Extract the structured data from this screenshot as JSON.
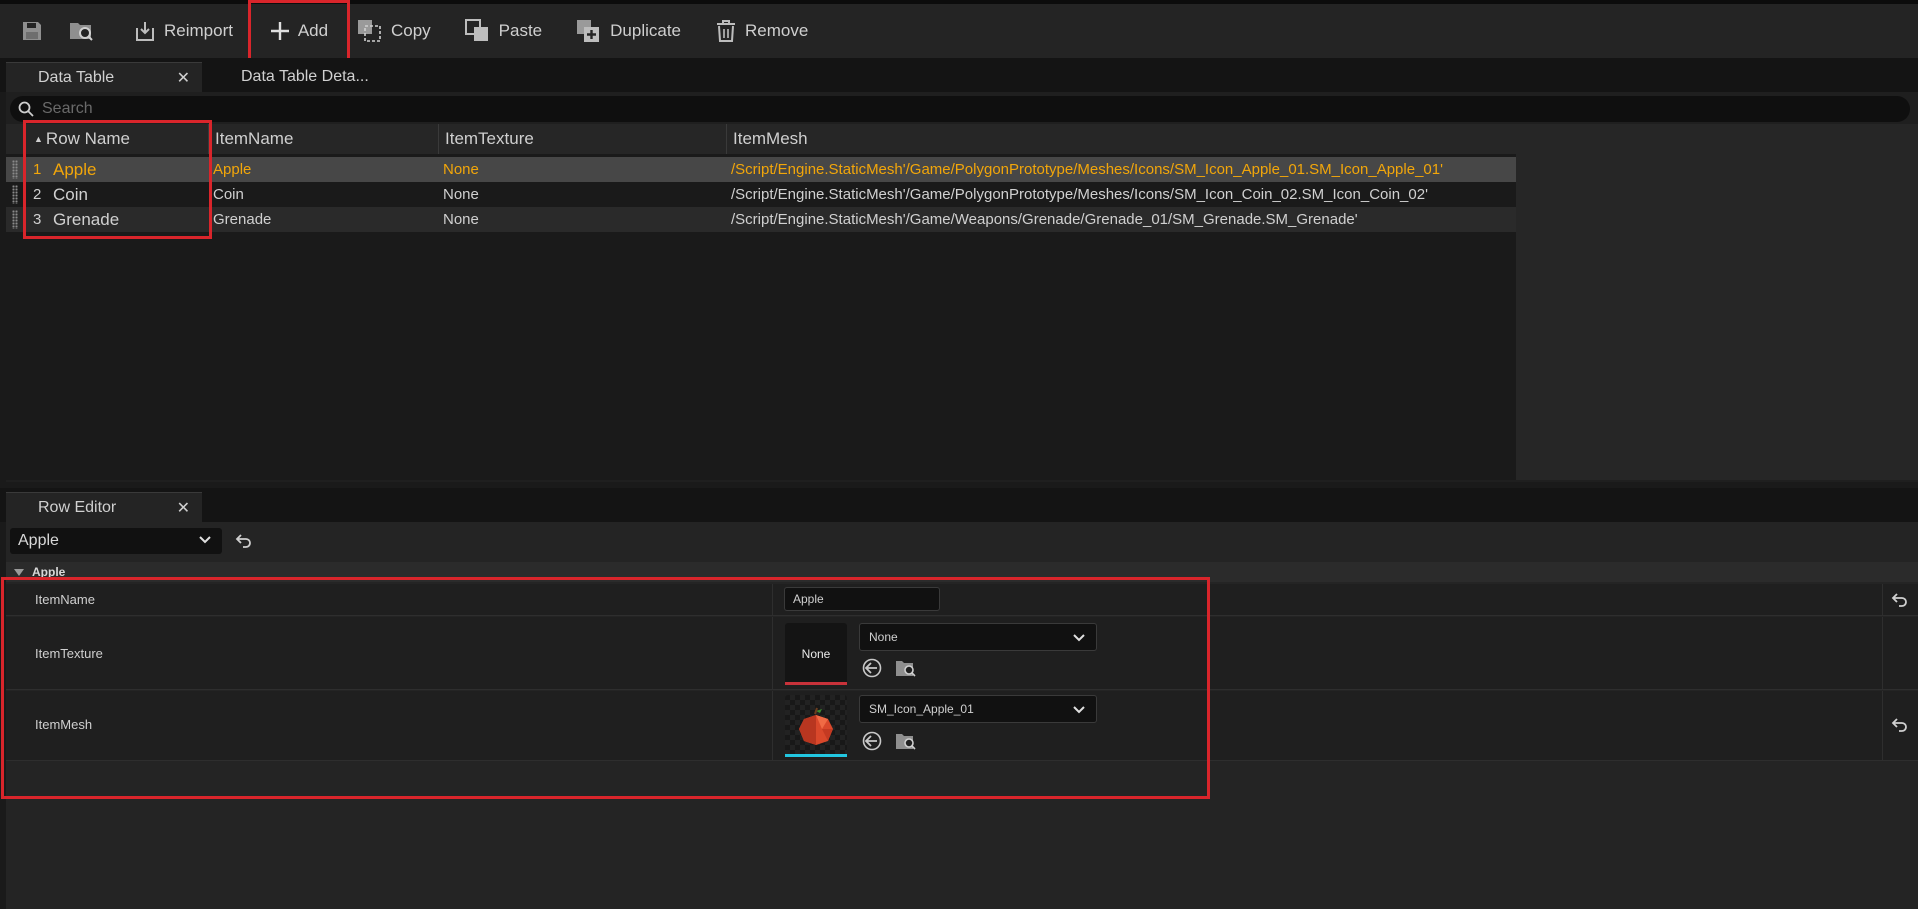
{
  "toolbar": {
    "save_icon": "save-icon",
    "browse_icon": "browse-in-content-icon",
    "reimport_label": "Reimport",
    "add_label": "Add",
    "copy_label": "Copy",
    "paste_label": "Paste",
    "duplicate_label": "Duplicate",
    "remove_label": "Remove"
  },
  "tabs": [
    {
      "label": "Data Table",
      "active": true
    },
    {
      "label": "Data Table Deta..."
    }
  ],
  "search": {
    "placeholder": "Search"
  },
  "table": {
    "columns": [
      "Row Name",
      "ItemName",
      "ItemTexture",
      "ItemMesh"
    ],
    "rows": [
      {
        "num": "1",
        "name": "Apple",
        "item_name": "Apple",
        "item_texture": "None",
        "item_mesh": "/Script/Engine.StaticMesh'/Game/PolygonPrototype/Meshes/Icons/SM_Icon_Apple_01.SM_Icon_Apple_01'",
        "selected": true
      },
      {
        "num": "2",
        "name": "Coin",
        "item_name": "Coin",
        "item_texture": "None",
        "item_mesh": "/Script/Engine.StaticMesh'/Game/PolygonPrototype/Meshes/Icons/SM_Icon_Coin_02.SM_Icon_Coin_02'"
      },
      {
        "num": "3",
        "name": "Grenade",
        "item_name": "Grenade",
        "item_texture": "None",
        "item_mesh": "/Script/Engine.StaticMesh'/Game/Weapons/Grenade/Grenade_01/SM_Grenade.SM_Grenade'"
      }
    ]
  },
  "row_editor": {
    "tab_label": "Row Editor",
    "selected_row": "Apple",
    "category": "Apple",
    "props": {
      "item_name": {
        "label": "ItemName",
        "value": "Apple"
      },
      "item_texture": {
        "label": "ItemTexture",
        "thumb_text": "None",
        "combo_value": "None"
      },
      "item_mesh": {
        "label": "ItemMesh",
        "combo_value": "SM_Icon_Apple_01"
      }
    }
  },
  "colors": {
    "accent_selected": "#f2a60a",
    "highlight_box": "#d9252b",
    "texture_bar": "#c8323a",
    "mesh_bar": "#22c6e0"
  }
}
